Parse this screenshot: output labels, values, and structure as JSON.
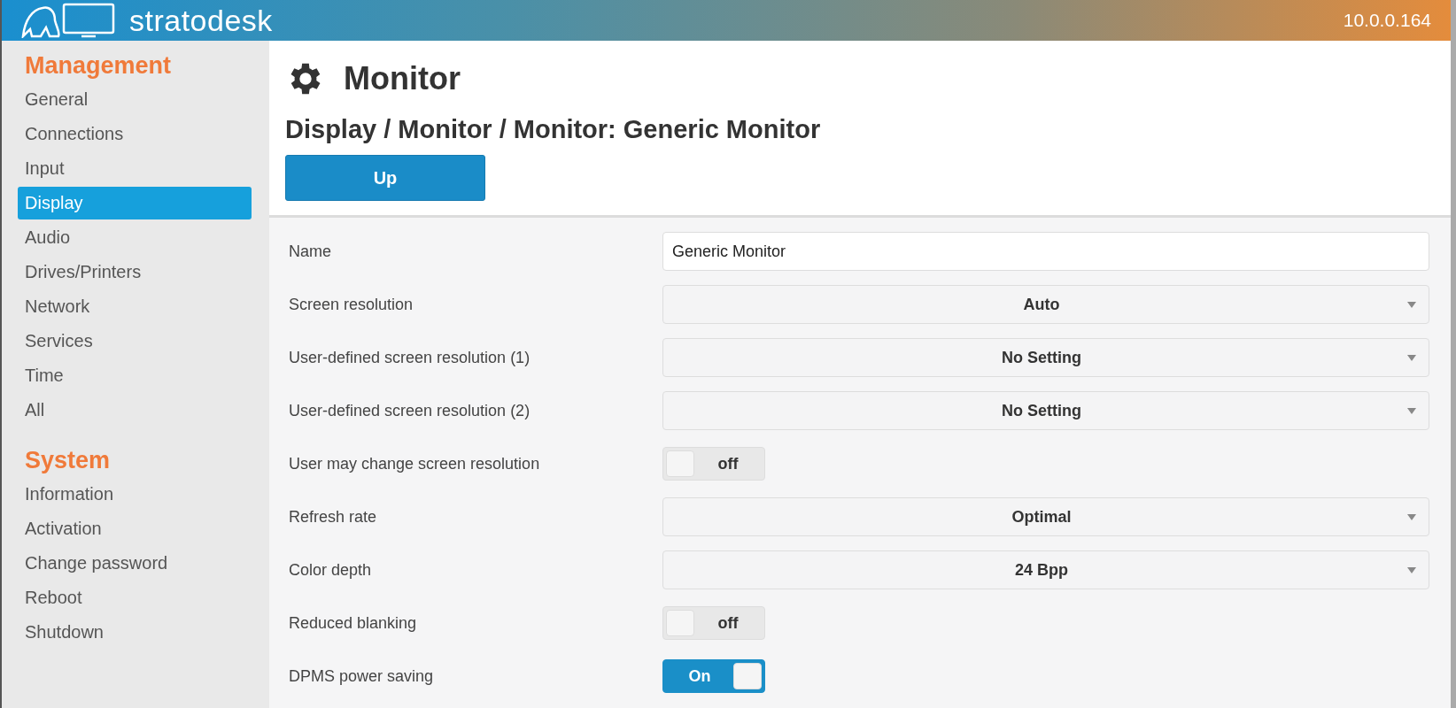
{
  "header": {
    "brand": "stratodesk",
    "address": "10.0.0.164"
  },
  "sidebar": {
    "sections": [
      {
        "title": "Management",
        "items": [
          {
            "label": "General",
            "selected": false
          },
          {
            "label": "Connections",
            "selected": false
          },
          {
            "label": "Input",
            "selected": false
          },
          {
            "label": "Display",
            "selected": true
          },
          {
            "label": "Audio",
            "selected": false
          },
          {
            "label": "Drives/Printers",
            "selected": false
          },
          {
            "label": "Network",
            "selected": false
          },
          {
            "label": "Services",
            "selected": false
          },
          {
            "label": "Time",
            "selected": false
          },
          {
            "label": "All",
            "selected": false
          }
        ]
      },
      {
        "title": "System",
        "items": [
          {
            "label": "Information",
            "selected": false
          },
          {
            "label": "Activation",
            "selected": false
          },
          {
            "label": "Change password",
            "selected": false
          },
          {
            "label": "Reboot",
            "selected": false
          },
          {
            "label": "Shutdown",
            "selected": false
          }
        ]
      }
    ]
  },
  "page": {
    "title": "Monitor",
    "breadcrumb": "Display / Monitor / Monitor: Generic Monitor",
    "up_button": "Up"
  },
  "form": [
    {
      "kind": "text",
      "label": "Name",
      "value": "Generic Monitor"
    },
    {
      "kind": "select",
      "label": "Screen resolution",
      "value": "Auto"
    },
    {
      "kind": "select",
      "label": "User-defined screen resolution (1)",
      "value": "No Setting"
    },
    {
      "kind": "select",
      "label": "User-defined screen resolution (2)",
      "value": "No Setting"
    },
    {
      "kind": "toggle",
      "label": "User may change screen resolution",
      "on": false,
      "state_text": "off"
    },
    {
      "kind": "select",
      "label": "Refresh rate",
      "value": "Optimal"
    },
    {
      "kind": "select",
      "label": "Color depth",
      "value": "24 Bpp"
    },
    {
      "kind": "toggle",
      "label": "Reduced blanking",
      "on": false,
      "state_text": "off"
    },
    {
      "kind": "toggle",
      "label": "DPMS power saving",
      "on": true,
      "state_text": "On"
    }
  ]
}
